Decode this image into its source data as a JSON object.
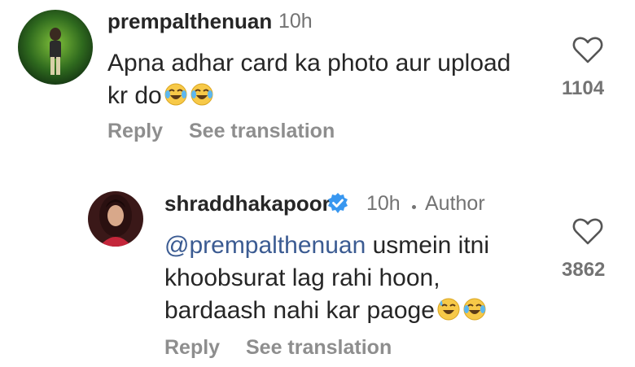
{
  "comments": [
    {
      "username": "prempalthenuan",
      "time": "10h",
      "line1": "Apna adhar card ka photo aur upload",
      "line2": "kr do",
      "emojis": [
        "joy-emoji",
        "joy-emoji"
      ],
      "actions": {
        "reply": "Reply",
        "translate": "See translation"
      },
      "likes": "1104"
    },
    {
      "username": "shraddhakapoor",
      "verified": true,
      "time": "10h",
      "author_label": "Author",
      "mention": "@prempalthenuan",
      "line1_rest": " usmein itni",
      "line2": "khoobsurat lag rahi hoon,",
      "line3": "bardaash nahi kar paoge",
      "emojis": [
        "sweat-smile-emoji",
        "joy-emoji"
      ],
      "actions": {
        "reply": "Reply",
        "translate": "See translation"
      },
      "likes": "3862"
    }
  ],
  "colors": {
    "text": "#262626",
    "muted": "#737373",
    "mention": "#3b5b92",
    "verified": "#3897f0"
  }
}
